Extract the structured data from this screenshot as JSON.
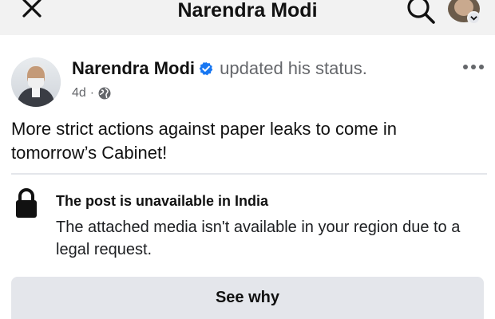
{
  "header": {
    "title": "Narendra Modi",
    "close_icon": "close-icon",
    "search_icon": "search-icon"
  },
  "post": {
    "author": "Narendra Modi",
    "verified": true,
    "action": "updated his status.",
    "time": "4d",
    "separator": "·",
    "audience_icon": "globe-icon",
    "text": "More strict actions against paper leaks to come in tomorrow’s Cabinet!"
  },
  "notice": {
    "title": "The post is unavailable in India",
    "body": "The attached media isn't available in your region due to a legal request.",
    "button_label": "See why"
  },
  "colors": {
    "verified_blue": "#1877f2",
    "secondary_text": "#65676b",
    "button_bg": "#e4e6eb"
  }
}
